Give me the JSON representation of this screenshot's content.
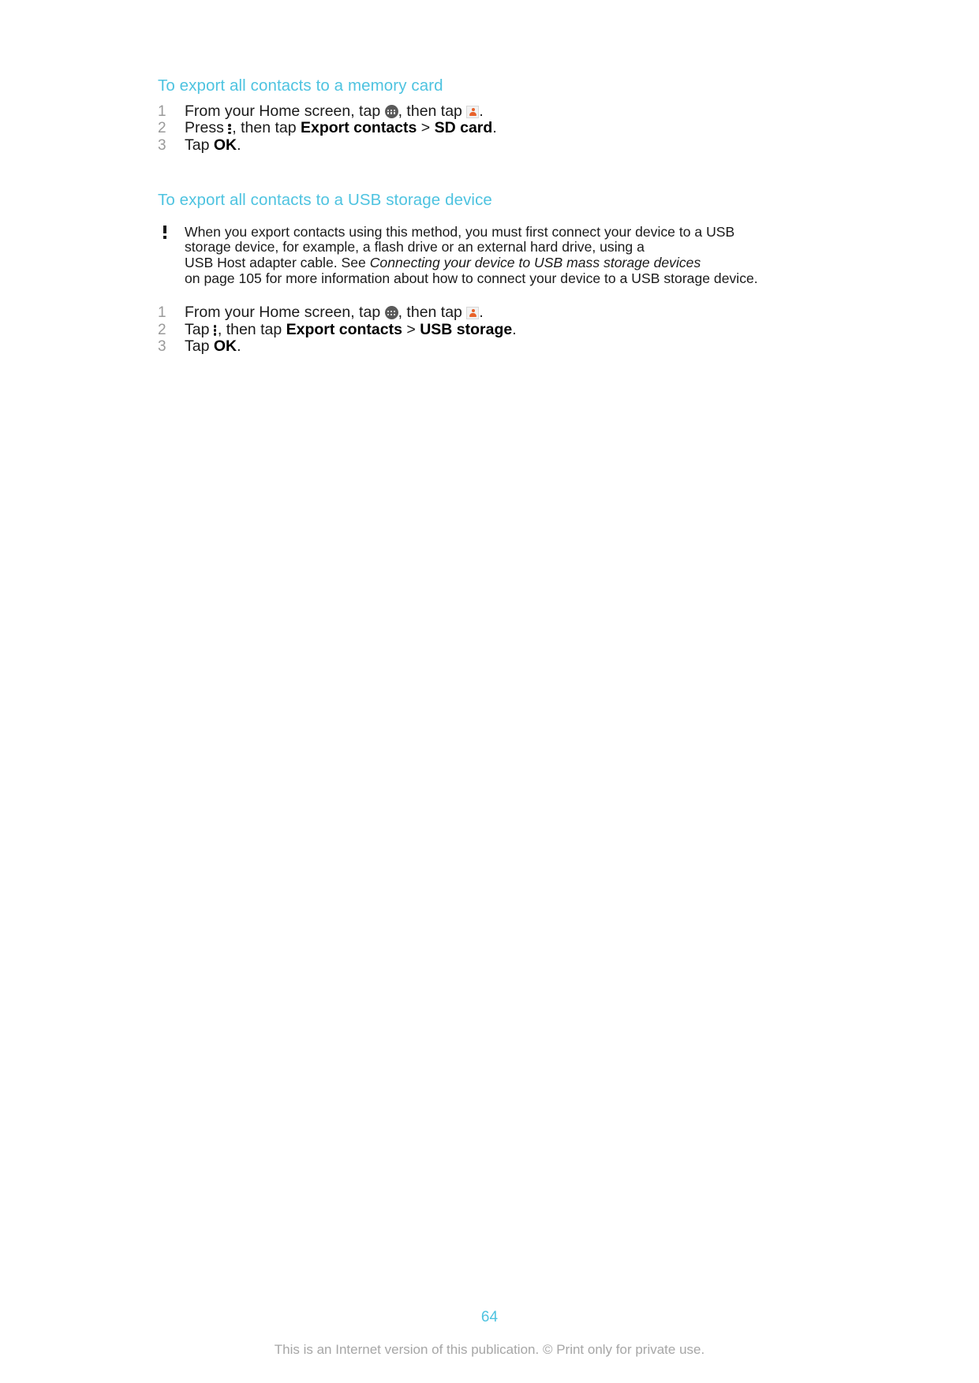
{
  "page": {
    "number": "64",
    "footer_note": "This is an Internet version of this publication. © Print only for private use.",
    "accent_color": "#4ec3e0",
    "text_color": "#1a1a1a",
    "number_color": "#9a9a9a",
    "footer_color": "#a6a6a6"
  },
  "sections": [
    {
      "heading": "To export all contacts to a memory card",
      "steps": [
        {
          "number": "1",
          "parts": [
            {
              "type": "text",
              "value": "From your Home screen, tap "
            },
            {
              "type": "icon",
              "value": "app-drawer-icon"
            },
            {
              "type": "text",
              "value": ", then tap "
            },
            {
              "type": "icon",
              "value": "contacts-icon"
            },
            {
              "type": "text",
              "value": "."
            }
          ]
        },
        {
          "number": "2",
          "parts": [
            {
              "type": "text",
              "value": "Press "
            },
            {
              "type": "icon",
              "value": "overflow-menu-icon"
            },
            {
              "type": "text",
              "value": ", then tap "
            },
            {
              "type": "bold",
              "value": "Export contacts"
            },
            {
              "type": "text",
              "value": " > "
            },
            {
              "type": "bold",
              "value": "SD card"
            },
            {
              "type": "text",
              "value": "."
            }
          ]
        },
        {
          "number": "3",
          "parts": [
            {
              "type": "text",
              "value": "Tap "
            },
            {
              "type": "bold",
              "value": "OK"
            },
            {
              "type": "text",
              "value": "."
            }
          ]
        }
      ]
    },
    {
      "heading": "To export all contacts to a USB storage device",
      "note": {
        "icon": "warning-exclamation-icon",
        "lines": [
          [
            {
              "type": "text",
              "value": "When you export contacts using this method, you must first connect your device to a USB"
            }
          ],
          [
            {
              "type": "text",
              "value": "storage device, for example, a flash drive or an external hard drive, using a"
            }
          ],
          [
            {
              "type": "text",
              "value": "USB Host adapter cable. See "
            },
            {
              "type": "italic",
              "value": "Connecting your device to USB mass storage devices"
            }
          ],
          [
            {
              "type": "text",
              "value": "on page 105 for more information about how to connect your device to a USB storage device."
            }
          ]
        ]
      },
      "steps": [
        {
          "number": "1",
          "parts": [
            {
              "type": "text",
              "value": "From your Home screen, tap "
            },
            {
              "type": "icon",
              "value": "app-drawer-icon"
            },
            {
              "type": "text",
              "value": ", then tap "
            },
            {
              "type": "icon",
              "value": "contacts-icon"
            },
            {
              "type": "text",
              "value": "."
            }
          ]
        },
        {
          "number": "2",
          "parts": [
            {
              "type": "text",
              "value": "Tap "
            },
            {
              "type": "icon",
              "value": "overflow-menu-icon"
            },
            {
              "type": "text",
              "value": ", then tap "
            },
            {
              "type": "bold",
              "value": "Export contacts"
            },
            {
              "type": "text",
              "value": " > "
            },
            {
              "type": "bold",
              "value": "USB storage"
            },
            {
              "type": "text",
              "value": "."
            }
          ]
        },
        {
          "number": "3",
          "parts": [
            {
              "type": "text",
              "value": "Tap "
            },
            {
              "type": "bold",
              "value": "OK"
            },
            {
              "type": "text",
              "value": "."
            }
          ]
        }
      ]
    }
  ]
}
